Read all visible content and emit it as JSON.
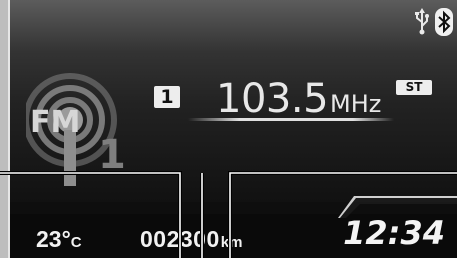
{
  "radio": {
    "band": "FM",
    "preset_number": "1",
    "frequency": "103.5",
    "frequency_unit": "MHz",
    "stereo": "ST",
    "logo_preset": "1"
  },
  "status": {
    "usb_icon": "usb-icon",
    "bluetooth_icon": "bluetooth-icon"
  },
  "footer": {
    "temperature_value": "23°",
    "temperature_unit": "C",
    "odometer_value": "002300",
    "odometer_unit": "km",
    "clock": "12:34"
  },
  "colors": {
    "display_background": "#0e0e0e",
    "text": "#e8e8e8",
    "badge": "#ededed"
  }
}
